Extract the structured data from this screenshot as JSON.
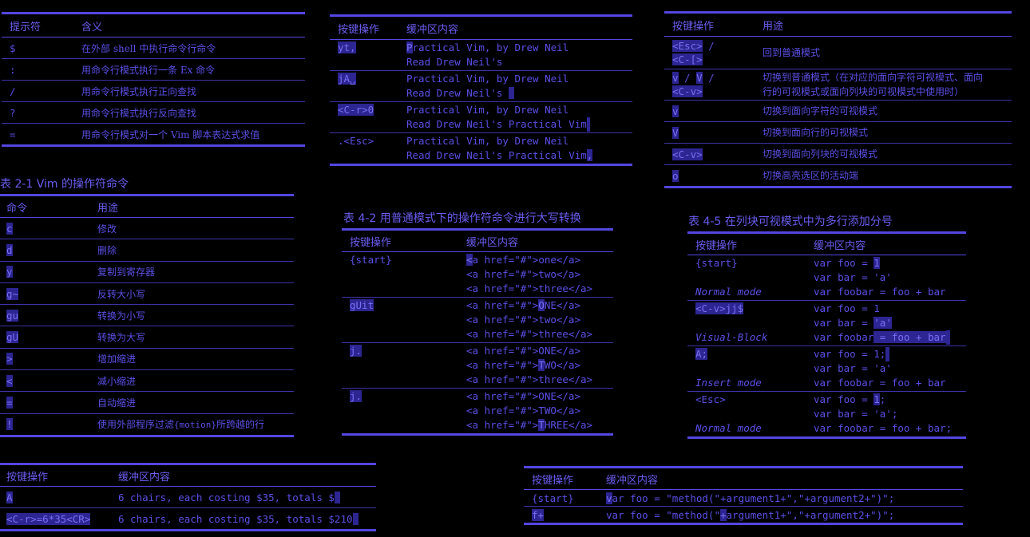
{
  "t_prompt": {
    "headers": [
      "提示符",
      "含义"
    ],
    "rows": [
      [
        "$",
        "在外部 shell 中执行命令行命令"
      ],
      [
        ":",
        "用命令行模式执行一条 Ex 命令"
      ],
      [
        "/",
        "用命令行模式执行正向查找"
      ],
      [
        "?",
        "用命令行模式执行反向查找"
      ],
      [
        "=",
        "用命令行模式对一个 Vim 脚本表达式求值"
      ]
    ]
  },
  "t_ops": {
    "caption": "表 2-1   Vim 的操作符命令",
    "headers": [
      "命令",
      "用途"
    ],
    "rows": [
      [
        "c",
        "修改"
      ],
      [
        "d",
        "删除"
      ],
      [
        "y",
        "复制到寄存器"
      ],
      [
        "g~",
        "反转大小写"
      ],
      [
        "gu",
        "转换为小写"
      ],
      [
        "gU",
        "转换为大写"
      ],
      [
        ">",
        "增加缩进"
      ],
      [
        "<",
        "减小缩进"
      ],
      [
        "=",
        "自动缩进"
      ],
      [
        "!",
        "使用外部程序过滤{motion}所跨越的行"
      ]
    ]
  },
  "t_calc": {
    "headers": [
      "按键操作",
      "缓冲区内容"
    ],
    "rows": [
      [
        "A",
        "6 chairs, each costing $35, totals $"
      ],
      [
        "<C-r>=6*35<CR>",
        "6 chairs, each costing $35, totals $210"
      ]
    ]
  },
  "t_paste": {
    "headers": [
      "按键操作",
      "缓冲区内容"
    ],
    "rows": [
      {
        "key": "yt,",
        "lines": [
          "Practical Vim, by Drew Neil",
          "Read Drew Neil's"
        ]
      },
      {
        "key": "jA␣",
        "lines": [
          "Practical Vim, by Drew Neil",
          "Read Drew Neil's "
        ]
      },
      {
        "key": "<C-r>0",
        "lines": [
          "Practical Vim, by Drew Neil",
          "Read Drew Neil's Practical Vim"
        ]
      },
      {
        "key": ".<Esc>",
        "lines": [
          "Practical Vim, by Drew Neil",
          "Read Drew Neil's Practical Vim,"
        ]
      }
    ]
  },
  "t_upper": {
    "caption": "表 4-2   用普通模式下的操作符命令进行大写转换",
    "headers": [
      "按键操作",
      "缓冲区内容"
    ],
    "rows": [
      {
        "key": "{start}",
        "lines": [
          "<a href=\"#\">one</a>",
          "<a href=\"#\">two</a>",
          "<a href=\"#\">three</a>"
        ]
      },
      {
        "key": "gUit",
        "lines": [
          "<a href=\"#\">ONE</a>",
          "<a href=\"#\">two</a>",
          "<a href=\"#\">three</a>"
        ]
      },
      {
        "key": "j.",
        "lines": [
          "<a href=\"#\">ONE</a>",
          "<a href=\"#\">TWO</a>",
          "<a href=\"#\">three</a>"
        ]
      },
      {
        "key": "j.",
        "lines": [
          "<a href=\"#\">ONE</a>",
          "<a href=\"#\">TWO</a>",
          "<a href=\"#\">THREE</a>"
        ]
      }
    ]
  },
  "t_method": {
    "headers": [
      "按键操作",
      "缓冲区内容"
    ],
    "rows": [
      [
        "{start}",
        "var foo = \"method(\"+argument1+\",\"+argument2+\")\";"
      ],
      [
        "f+",
        "var foo = \"method(\"+argument1+\",\"+argument2+\")\";"
      ]
    ]
  },
  "t_visual": {
    "headers": [
      "按键操作",
      "用途"
    ],
    "rows": [
      {
        "key": [
          "<Esc> /",
          "<C-[>"
        ],
        "desc": [
          "回到普通模式"
        ]
      },
      {
        "key": [
          "v / V /",
          "<C-v>"
        ],
        "desc": [
          "切换到普通模式（在对应的面向字符可视模式、面向",
          "行的可视模式或面向列块的可视模式中使用时）"
        ]
      },
      {
        "key": [
          "v"
        ],
        "desc": [
          "切换到面向字符的可视模式"
        ]
      },
      {
        "key": [
          "V"
        ],
        "desc": [
          "切换到面向行的可视模式"
        ]
      },
      {
        "key": [
          "<C-v>"
        ],
        "desc": [
          "切换到面向列块的可视模式"
        ]
      },
      {
        "key": [
          "o"
        ],
        "desc": [
          "切换高亮选区的活动端"
        ]
      }
    ]
  },
  "t_semicolon": {
    "caption": "表 4-5   在列块可视模式中为多行添加分号",
    "headers": [
      "按键操作",
      "缓冲区内容"
    ],
    "rows": [
      {
        "key": "{start}",
        "mode": "Normal mode",
        "lines": [
          "var foo = 1",
          "var bar = 'a'",
          "var foobar = foo + bar"
        ]
      },
      {
        "key": "<C-v>jj$",
        "mode": "Visual-Block",
        "lines": [
          "var foo = 1",
          "var bar = 'a'",
          "var foobar = foo + bar"
        ]
      },
      {
        "key": "A;",
        "mode": "Insert mode",
        "lines": [
          "var foo = 1;",
          "var bar = 'a'",
          "var foobar = foo + bar"
        ]
      },
      {
        "key": "<Esc>",
        "mode": "Normal mode",
        "lines": [
          "var foo = 1;",
          "var bar = 'a';",
          "var foobar = foo + bar;"
        ]
      }
    ]
  }
}
